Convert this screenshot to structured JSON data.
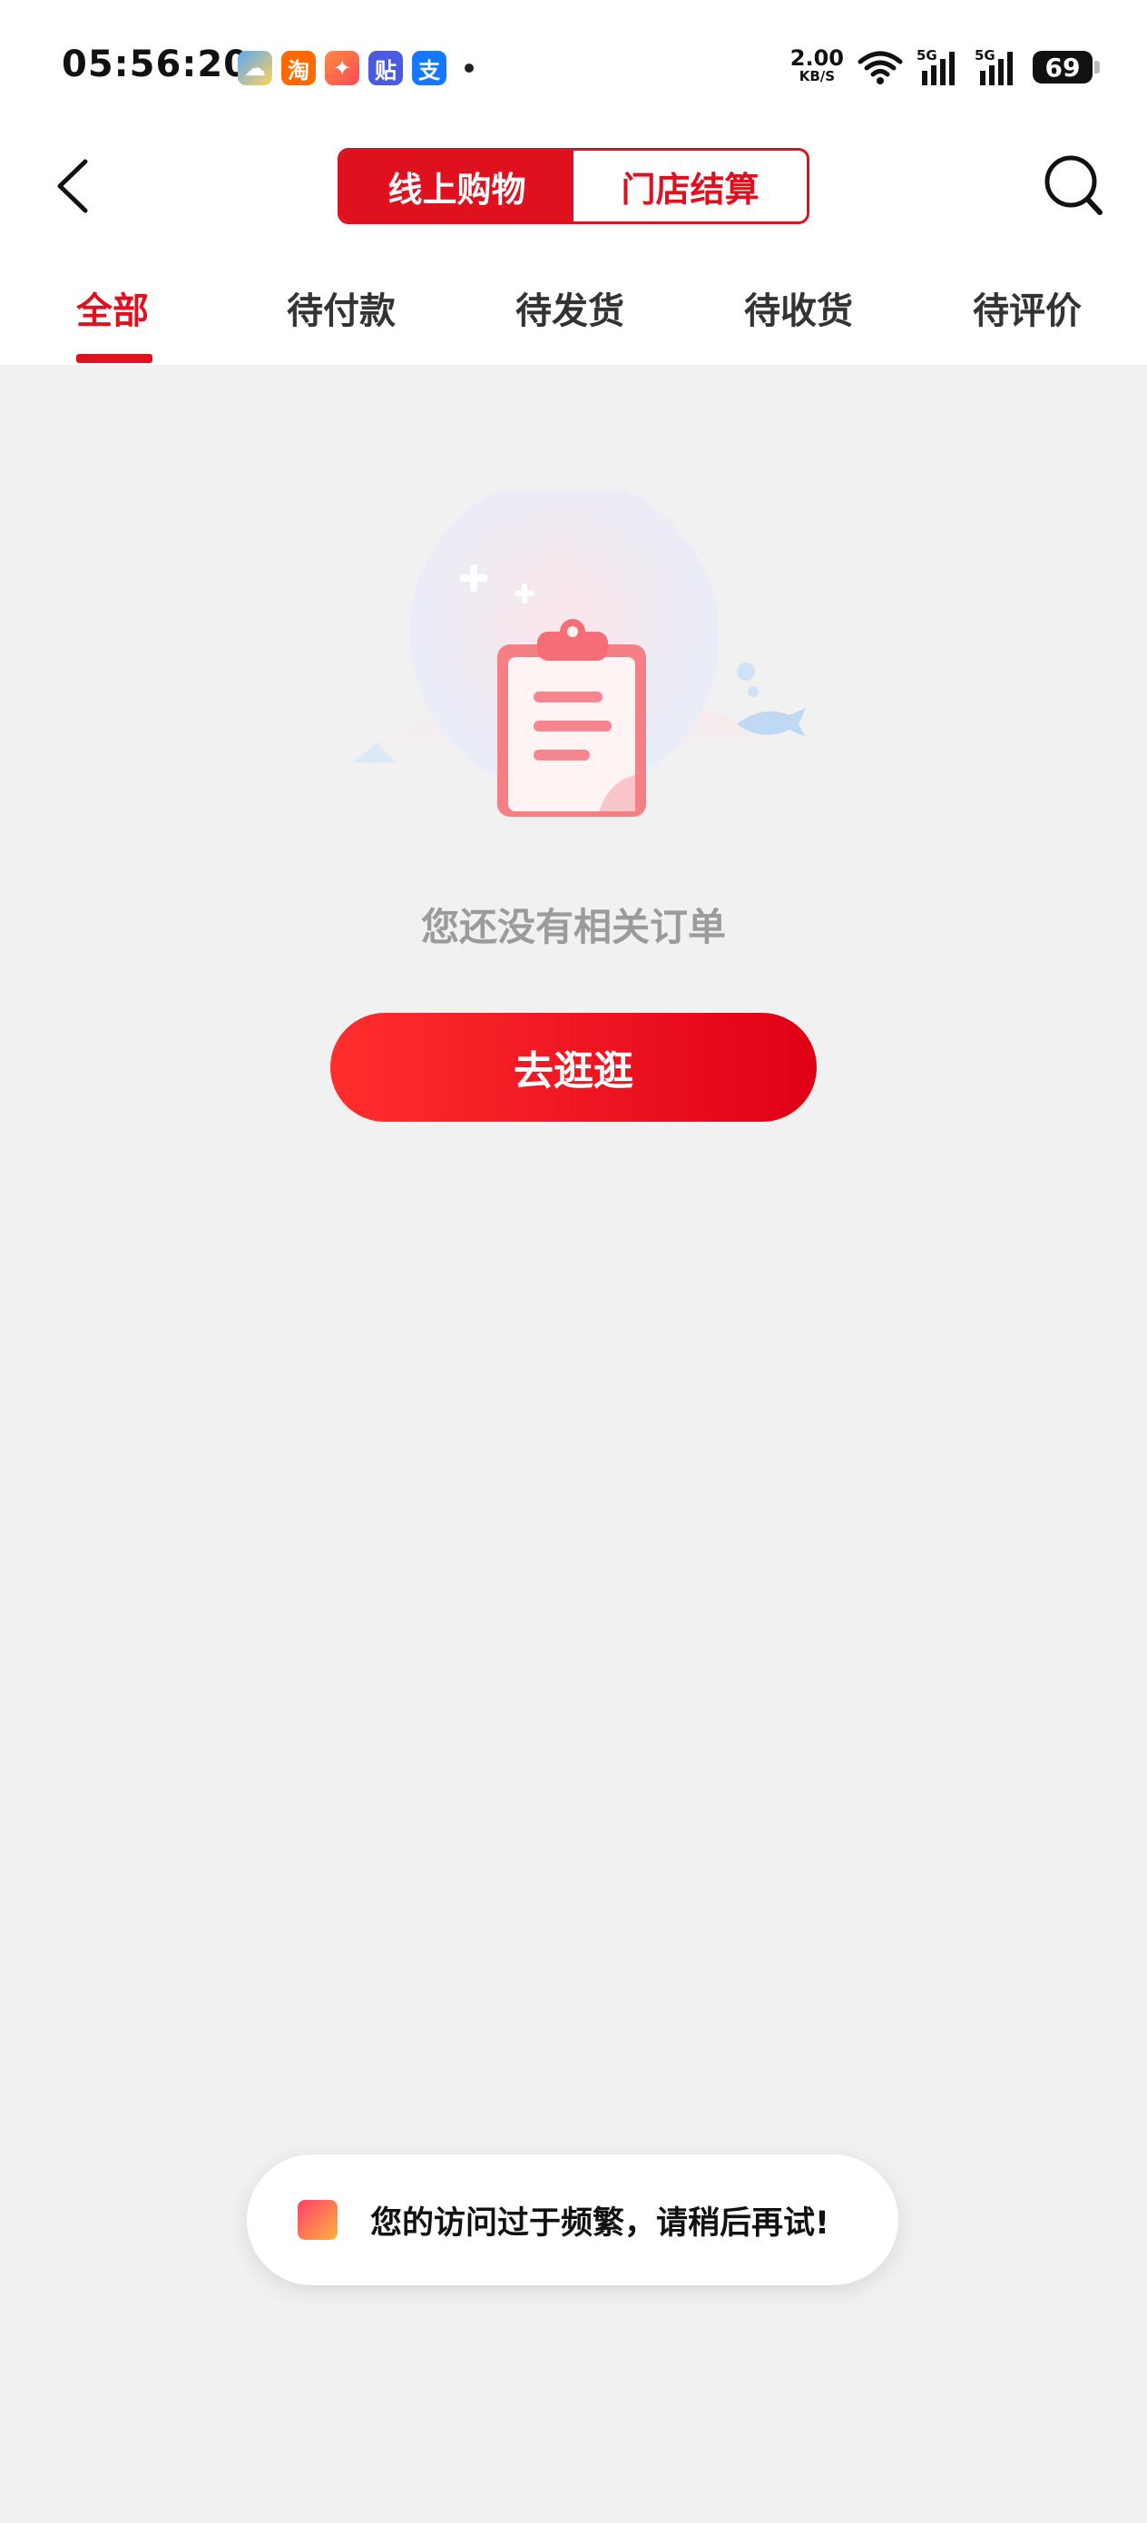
{
  "status_bar": {
    "time": "05:56:20",
    "app_icons": [
      {
        "name": "weather-icon",
        "glyph": ""
      },
      {
        "name": "taobao-icon",
        "glyph": "淘"
      },
      {
        "name": "game-icon",
        "glyph": ""
      },
      {
        "name": "tieba-icon",
        "glyph": "贴"
      },
      {
        "name": "alipay-icon",
        "glyph": "支"
      }
    ],
    "net_speed": "2.00",
    "net_unit": "KB/S",
    "signal_1": "5G",
    "signal_2": "5G",
    "battery": "69"
  },
  "nav": {
    "segments": [
      {
        "label": "线上购物",
        "active": true
      },
      {
        "label": "门店结算",
        "active": false
      }
    ]
  },
  "tabs": [
    {
      "label": "全部",
      "active": true
    },
    {
      "label": "待付款",
      "active": false
    },
    {
      "label": "待发货",
      "active": false
    },
    {
      "label": "待收货",
      "active": false
    },
    {
      "label": "待评价",
      "active": false
    }
  ],
  "empty": {
    "message": "您还没有相关订单",
    "button": "去逛逛"
  },
  "toast": {
    "message": "您的访问过于频繁，请稍后再试!"
  },
  "colors": {
    "brand": "#e0111f",
    "background": "#f1f1f2"
  }
}
